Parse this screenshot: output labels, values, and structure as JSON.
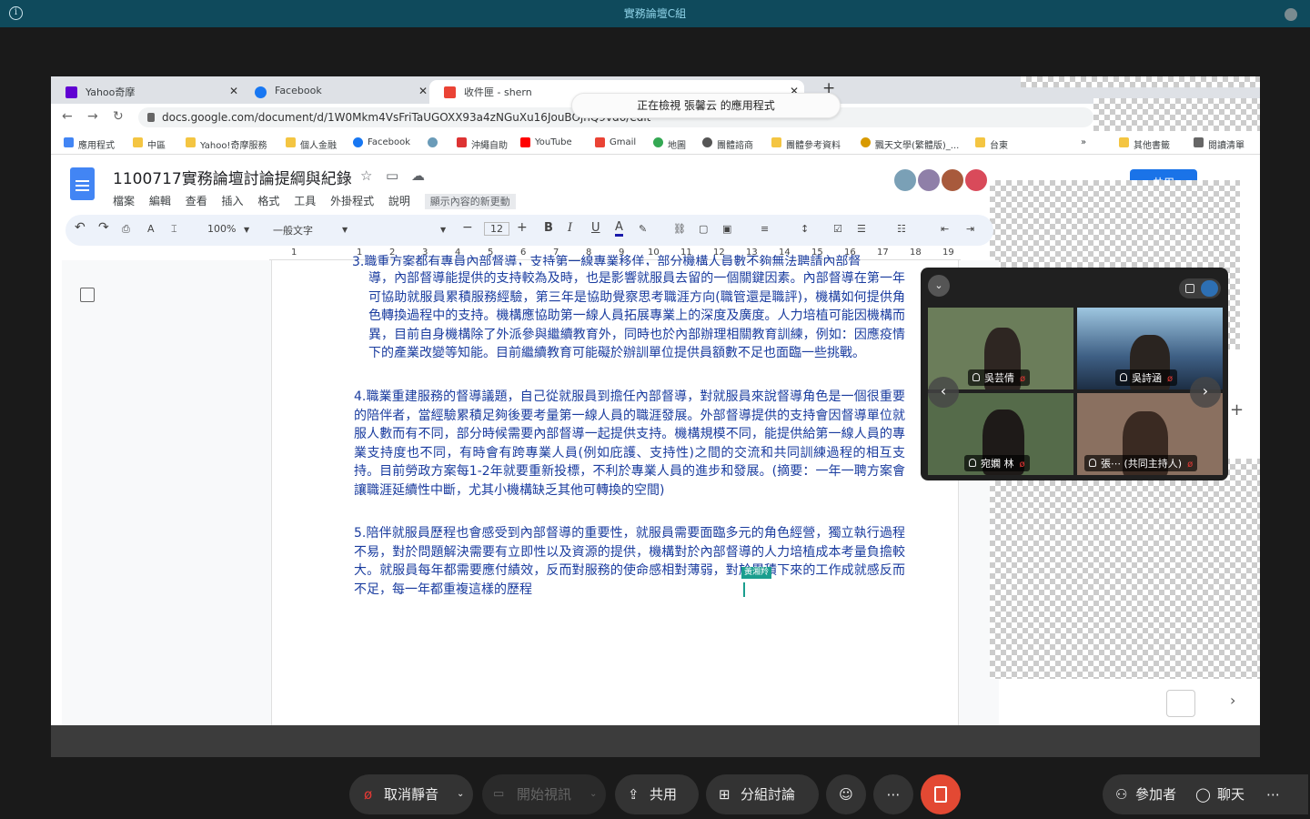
{
  "meeting": {
    "title": "實務論壇C組"
  },
  "browser": {
    "tabs": [
      {
        "label": "Yahoo奇摩",
        "color": "#6001d2"
      },
      {
        "label": "Facebook",
        "color": "#1877f2"
      },
      {
        "label": "收件匣 - shern",
        "color": "#ea4335"
      }
    ],
    "url": "docs.google.com/document/d/1W0Mkm4VsFriTaUGOXX93a4zNGuXu16JouBOjhQ9vd6/edit",
    "viewing_notice": "正在檢視 張馨云 的應用程式",
    "bookmarks": [
      "應用程式",
      "中區",
      "Yahoo!奇摩服務",
      "個人金融",
      "Facebook",
      "",
      "沖繩自助",
      "YouTube",
      "Gmail",
      "地圖",
      "團體諮商",
      "團體參考資料",
      "飄天文學(繁體版)_...",
      "台東",
      "»",
      "其他書籤",
      "閱讀清單"
    ]
  },
  "doc": {
    "title": "1100717實務論壇討論提綱與紀錄",
    "menus": [
      "檔案",
      "編輯",
      "查看",
      "插入",
      "格式",
      "工具",
      "外掛程式",
      "說明"
    ],
    "changes_label": "顯示內容的新更動",
    "share_label": "共用",
    "zoom": "100%",
    "style": "一般文字",
    "font_size": "12",
    "ruler": [
      "1",
      "1",
      "2",
      "3",
      "4",
      "5",
      "6",
      "7",
      "8",
      "9",
      "10",
      "11",
      "12",
      "13",
      "14",
      "15",
      "16",
      "17",
      "18",
      "19"
    ],
    "para3_partial": "3.職重方案都有專員內部督導，支持第一線專業移佯，部分機構人員數不夠無法聘請內部督",
    "para3_rest": "導，內部督導能提供的支持較為及時，也是影響就服員去留的一個關鍵因素。內部督導在第一年可協助就服員累積服務經驗，第三年是協助覺察思考職涯方向(職管還是職評)，機構如何提供角色轉換過程中的支持。機構應協助第一線人員拓展專業上的深度及廣度。人力培植可能因機構而異，目前自身機構除了外派參與繼續教育外，同時也於內部辦理相關教育訓練，例如：因應疫情下的產業改變等知能。目前繼續教育可能礙於辦訓單位提供員額數不足也面臨一些挑戰。",
    "para4": "4.職業重建服務的督導議題，自己從就服員到擔任內部督導，對就服員來說督導角色是一個很重要的陪伴者，當經驗累積足夠後要考量第一線人員的職涯發展。外部督導提供的支持會因督導單位就服人數而有不同，部分時候需要內部督導一起提供支持。機構規模不同，能提供給第一線人員的專業支持度也不同，有時會有跨專業人員(例如庇護、支持性)之間的交流和共同訓練過程的相互支持。目前勞政方案每1-2年就要重新投標，不利於專業人員的進步和發展。(摘要：一年一聘方案會讓職涯延續性中斷，尤其小機構缺乏其他可轉換的空間)",
    "para5": "5.陪伴就服員歷程也會感受到內部督導的重要性，就服員需要面臨多元的角色經營，獨立執行過程不易，對於問題解決需要有立即性以及資源的提供，機構對於內部督導的人力培植成本考量負擔較大。就服員每年都需要應付績效，反而對服務的使命感相對薄弱，對於累積下來的工作成就感反而不足，每一年都重複這樣的歷程",
    "cursor_user": "黃湘羚"
  },
  "gallery": {
    "participants": [
      {
        "name": "吳芸倩",
        "bg": "#6b7d5a"
      },
      {
        "name": "吳詩涵",
        "bg": "#3e5f84"
      },
      {
        "name": "宛嫻 林",
        "bg": "#556b4a"
      },
      {
        "name": "張⋯ (共同主持人)",
        "bg": "#8a7060"
      }
    ]
  },
  "controls": {
    "mute": "取消靜音",
    "video": "開始視訊",
    "share": "共用",
    "breakout": "分組討論",
    "more": "⋯",
    "participants": "參加者",
    "chat": "聊天"
  }
}
